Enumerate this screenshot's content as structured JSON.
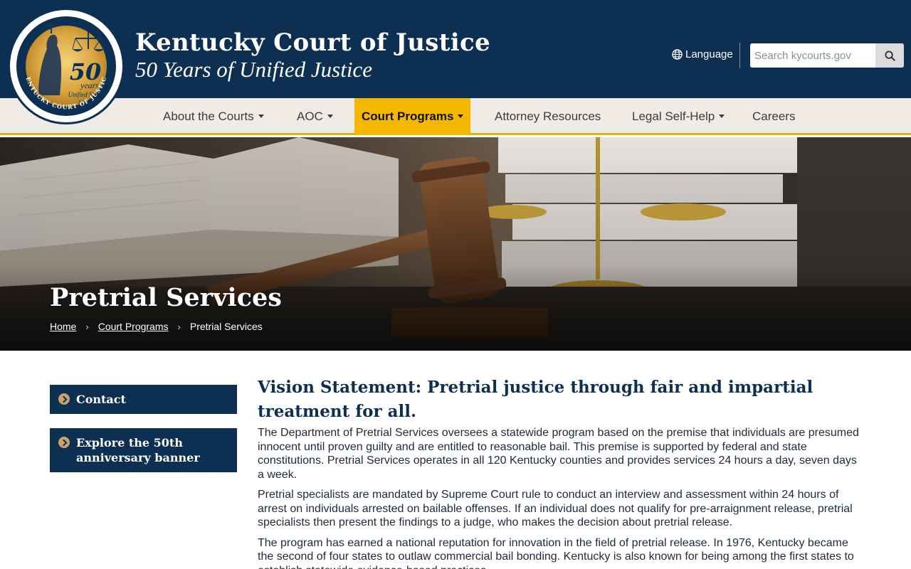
{
  "header": {
    "seal": {
      "number": "50",
      "years": "years",
      "unified_since": "Unified Since",
      "year": "1976",
      "ring_text": "KENTUCKY COURT OF JUSTICE"
    },
    "title": "Kentucky Court of Justice",
    "tagline": "50 Years of Unified Justice",
    "language_label": "Language",
    "search_placeholder": "Search kycourts.gov"
  },
  "nav": {
    "items": [
      {
        "label": "About the Courts",
        "dropdown": true
      },
      {
        "label": "AOC",
        "dropdown": true
      },
      {
        "label": "Court Programs",
        "dropdown": true,
        "active": true
      },
      {
        "label": "Attorney Resources",
        "dropdown": false
      },
      {
        "label": "Legal Self-Help",
        "dropdown": true
      },
      {
        "label": "Careers",
        "dropdown": false
      }
    ]
  },
  "hero": {
    "title": "Pretrial Services",
    "breadcrumb": [
      "Home",
      "Court Programs",
      "Pretrial Services"
    ]
  },
  "sidebar": {
    "links": [
      {
        "label": "Contact"
      },
      {
        "label": "Explore the 50th anniversary banner"
      }
    ]
  },
  "main": {
    "heading": "Vision Statement: Pretrial justice through fair and impartial treatment for all.",
    "paragraphs": [
      "The Department of Pretrial Services oversees a statewide program based on the premise that individuals are presumed innocent until proven guilty and are entitled to reasonable bail. This premise is supported by federal and state constitutions. Pretrial Services operates in all 120 Kentucky counties and provides services 24 hours a day, seven days a week.",
      "Pretrial specialists are mandated by Supreme Court rule to conduct an interview and assessment within 24 hours of arrest on individuals arrested on bailable offenses. If an individual does not qualify for pre-arraignment release, pretrial specialists then present the findings to a judge, who makes the decision about pretrial release.",
      "The program has earned a national reputation for innovation in the field of pretrial release. In 1976, Kentucky became the second of four states to outlaw commercial bail bonding. Kentucky is also known for being among the first states to establish statewide evidence-based practices."
    ]
  },
  "colors": {
    "navy": "#0d2f52",
    "gold": "#f5b800",
    "nav_bg": "#efece6"
  }
}
